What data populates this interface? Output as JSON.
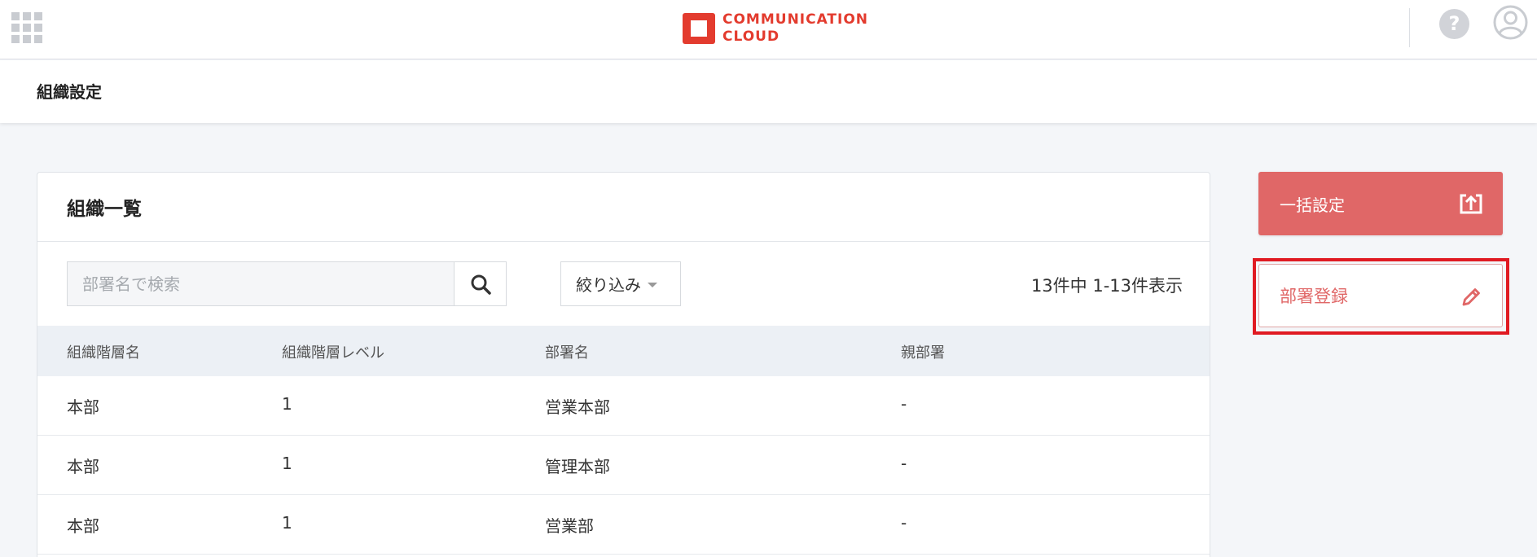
{
  "header": {
    "logo_line1": "COMMUNICATION",
    "logo_line2": "CLOUD",
    "help_glyph": "?",
    "icons": [
      "apps-grid-icon",
      "help-icon",
      "user-avatar-icon"
    ]
  },
  "page": {
    "title": "組織設定"
  },
  "card": {
    "title": "組織一覧",
    "search": {
      "placeholder": "部署名で検索",
      "value": ""
    },
    "filter_label": "絞り込み",
    "count_text": "13件中 1-13件表示",
    "columns": [
      "組織階層名",
      "組織階層レベル",
      "部署名",
      "親部署"
    ],
    "rows": [
      [
        "本部",
        "1",
        "営業本部",
        "-"
      ],
      [
        "本部",
        "1",
        "管理本部",
        "-"
      ],
      [
        "本部",
        "1",
        "営業部",
        "-"
      ]
    ]
  },
  "actions": {
    "bulk_label": "一括設定",
    "register_label": "部署登録"
  },
  "colors": {
    "brand": "#e33b2e",
    "bulk_button": "#e06767",
    "highlight": "#e01a22",
    "table_header_bg": "#ecf0f5"
  }
}
